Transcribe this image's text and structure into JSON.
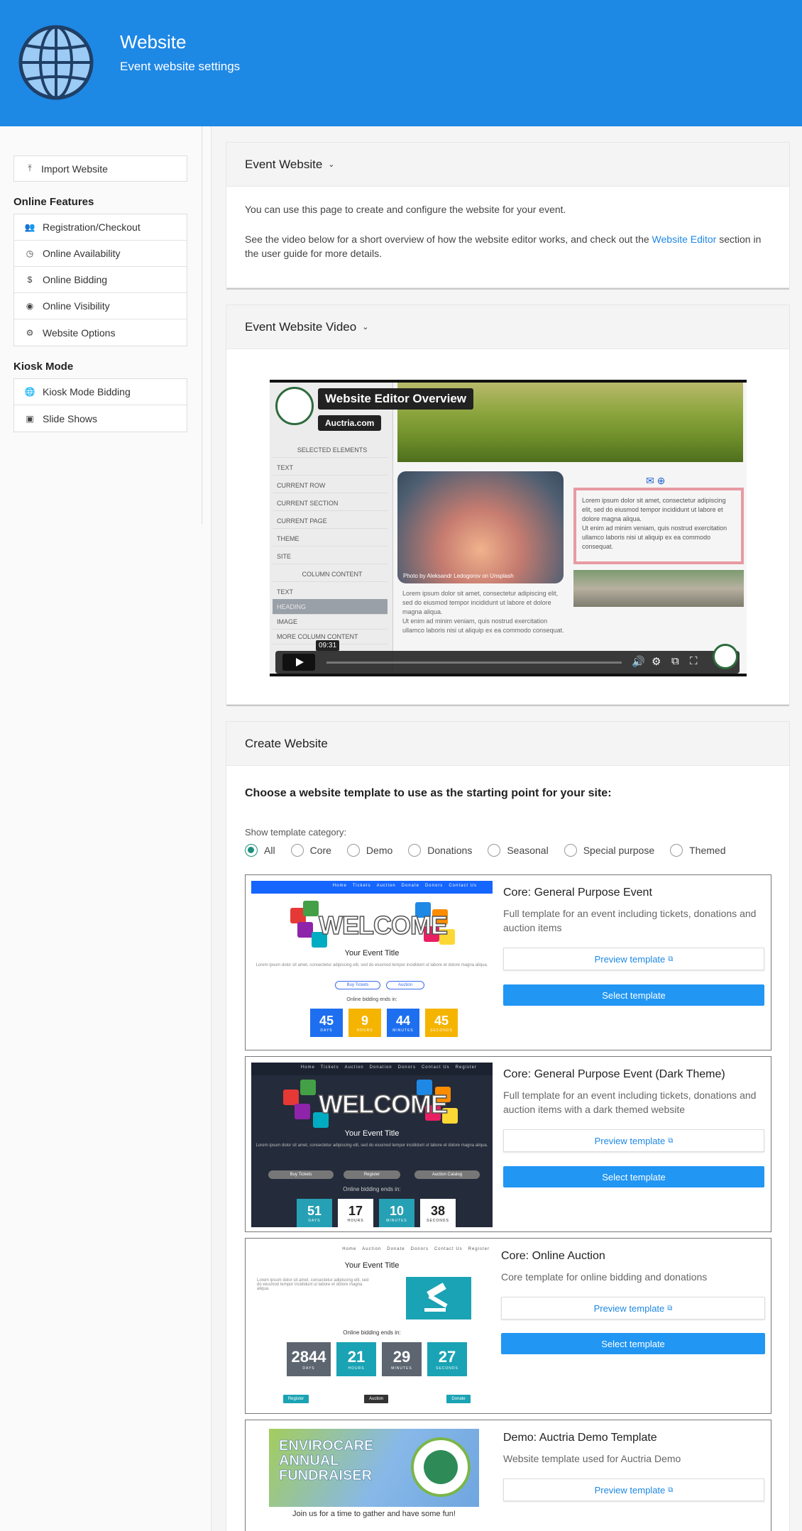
{
  "header": {
    "title": "Website",
    "subtitle": "Event website settings",
    "icon": "globe-icon",
    "bg_color": "#1e88e5"
  },
  "sidebar": {
    "import_label": "Import Website",
    "online_features_heading": "Online Features",
    "online_features": [
      {
        "label": "Registration/Checkout",
        "icon": "people-icon"
      },
      {
        "label": "Online Availability",
        "icon": "clock-icon"
      },
      {
        "label": "Online Bidding",
        "icon": "dollar-icon"
      },
      {
        "label": "Online Visibility",
        "icon": "eye-icon"
      },
      {
        "label": "Website Options",
        "icon": "gear-icon"
      }
    ],
    "kiosk_heading": "Kiosk Mode",
    "kiosk_items": [
      {
        "label": "Kiosk Mode Bidding",
        "icon": "globe-icon"
      },
      {
        "label": "Slide Shows",
        "icon": "slideshow-icon"
      }
    ]
  },
  "event_website": {
    "title": "Event Website",
    "intro": "You can use this page to create and configure the website for your event.",
    "video_text_before": "See the video below for a short overview of how the website editor works, and check out the ",
    "video_link": "Website Editor",
    "video_text_after": " section in the user guide for more details."
  },
  "video_card": {
    "title": "Event Website Video",
    "video_title": "Website Editor Overview",
    "channel": "Auctria.com",
    "timestamp": "09:31",
    "panel_rows": [
      "SELECTED ELEMENTS",
      "TEXT",
      "CURRENT ROW",
      "CURRENT SECTION",
      "CURRENT PAGE",
      "THEME",
      "SITE",
      "COLUMN CONTENT",
      "TEXT",
      "HEADING",
      "IMAGE",
      "MORE COLUMN CONTENT"
    ],
    "photo_credit": "Photo by Aleksandr Ledogorov on Unsplash",
    "box_text": "Lorem ipsum dolor sit amet, consectetur adipiscing elit, sed do eiusmod tempor incididunt ut labore et dolore magna aliqua.\nUt enim ad minim veniam, quis nostrud exercitation ullamco laboris nisi ut aliquip ex ea commodo consequat.",
    "lorem_text": "Lorem ipsum dolor sit amet, consectetur adipiscing elit, sed do eiusmod tempor incididunt ut labore et dolore magna aliqua.\nUt enim ad minim veniam, quis nostrud exercitation ullamco laboris nisi ut aliquip ex ea commodo consequat."
  },
  "create": {
    "title": "Create Website",
    "prompt": "Choose a website template to use as the starting point for your site:",
    "category_label": "Show template category:",
    "categories": [
      "All",
      "Core",
      "Demo",
      "Donations",
      "Seasonal",
      "Special purpose",
      "Themed"
    ],
    "selected_category": "All",
    "preview_label": "Preview template",
    "select_label": "Select template",
    "templates": [
      {
        "name": "Core: General Purpose Event",
        "description": "Full template for an event including tickets, donations and auction items"
      },
      {
        "name": "Core: General Purpose Event (Dark Theme)",
        "description": "Full template for an event including tickets, donations and auction items with a dark themed website"
      },
      {
        "name": "Core: Online Auction",
        "description": "Core template for online bidding and donations"
      },
      {
        "name": "Demo: Auctria Demo Template",
        "description": "Website template used for Auctria Demo"
      }
    ]
  },
  "thumbs": {
    "nav1": [
      "Home",
      "Tickets",
      "Auction",
      "Donate",
      "Donors",
      "Contact Us"
    ],
    "nav2": [
      "Home",
      "Tickets",
      "Auction",
      "Donation",
      "Donors",
      "Contact Us",
      "Register"
    ],
    "nav3": [
      "Home",
      "Auction",
      "Donate",
      "Donors",
      "Contact Us",
      "Register"
    ],
    "welcome": "WELCOME",
    "event_title": "Your Event Title",
    "bidding_ends": "Online bidding ends in:",
    "t1_buttons": [
      "Buy Tickets",
      "Auction"
    ],
    "t2_buttons": [
      "Buy Tickets",
      "Register",
      "Auction Catalog"
    ],
    "t3_buttons": [
      "Register",
      "Auction",
      "Donate"
    ],
    "count_labels": [
      "DAYS",
      "HOURS",
      "MINUTES",
      "SECONDS"
    ],
    "t1_counts": [
      "45",
      "9",
      "44",
      "45"
    ],
    "t2_counts": [
      "51",
      "17",
      "10",
      "38"
    ],
    "t3_counts": [
      "2844",
      "21",
      "29",
      "27"
    ],
    "demo_banner": "ENVIROCARE ANNUAL FUNDRAISER",
    "demo_tagline": "Join us for a time to gather and have some fun!"
  }
}
